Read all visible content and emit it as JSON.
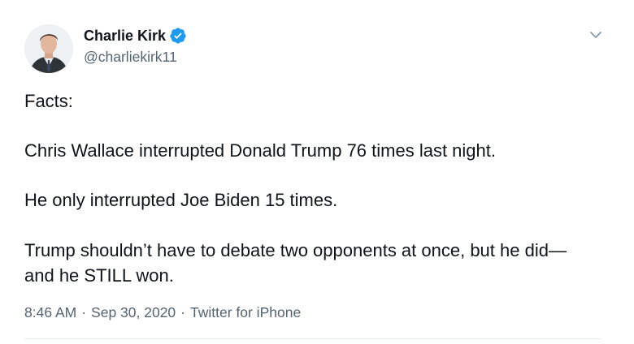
{
  "author": {
    "display_name": "Charlie Kirk",
    "handle": "@charliekirk11",
    "verified": true
  },
  "tweet": {
    "paragraphs": {
      "p1": "Facts:",
      "p2": "Chris Wallace interrupted Donald Trump 76 times last night.",
      "p3": "He only interrupted Joe Biden 15 times.",
      "p4_line1": "Trump shouldn’t have to debate two opponents at once, but he did—",
      "p4_line2": "and he STILL won."
    }
  },
  "meta": {
    "time": "8:46 AM",
    "separator1": "·",
    "date": "Sep 30, 2020",
    "separator2": "·",
    "source": "Twitter for iPhone"
  },
  "colors": {
    "verified_blue": "#1d9bf0",
    "secondary_text": "#536471",
    "primary_text": "#0f1419"
  },
  "icons": {
    "verified": "verified-badge-icon",
    "caret": "chevron-down-icon"
  }
}
